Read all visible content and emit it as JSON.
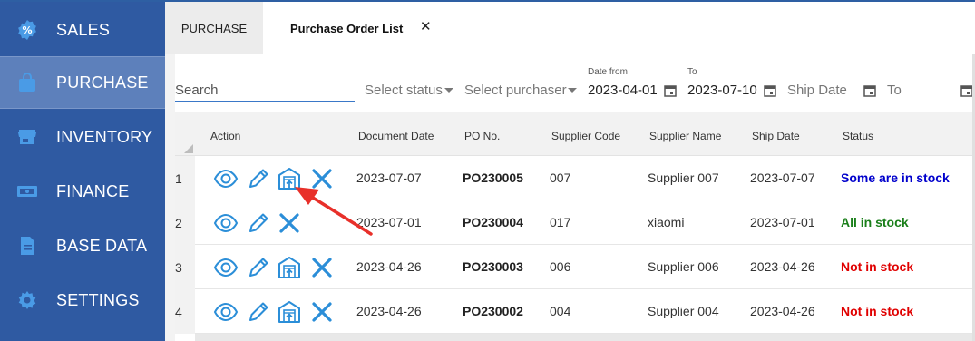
{
  "sidebar": {
    "items": [
      {
        "label": "SALES",
        "icon": "sales-badge-icon",
        "active": false
      },
      {
        "label": "PURCHASE",
        "icon": "shopping-bag-icon",
        "active": true
      },
      {
        "label": "INVENTORY",
        "icon": "store-icon",
        "active": false
      },
      {
        "label": "FINANCE",
        "icon": "cash-icon",
        "active": false
      },
      {
        "label": "BASE DATA",
        "icon": "document-icon",
        "active": false
      },
      {
        "label": "SETTINGS",
        "icon": "gear-icon",
        "active": false
      }
    ],
    "colors": {
      "background": "#2f5aa2",
      "active": "#5d80bb"
    }
  },
  "tabs": {
    "items": [
      {
        "label": "PURCHASE"
      },
      {
        "label": "Purchase Order List",
        "close": "✕"
      }
    ]
  },
  "filters": {
    "search_placeholder": "Search",
    "status_placeholder": "Select status",
    "purchaser_placeholder": "Select purchaser",
    "date_from_label": "Date from",
    "date_from_value": "2023-04-01",
    "date_to_label": "To",
    "date_to_value": "2023-07-10",
    "ship_date_placeholder": "Ship Date",
    "ship_to_placeholder": "To"
  },
  "table": {
    "headers": {
      "action": "Action",
      "document_date": "Document Date",
      "po_no": "PO No.",
      "supplier_code": "Supplier Code",
      "supplier_name": "Supplier Name",
      "ship_date": "Ship Date",
      "status": "Status"
    },
    "rows": [
      {
        "num": "1",
        "document_date": "2023-07-07",
        "po_no": "PO230005",
        "supplier_code": "007",
        "supplier_name": "Supplier 007",
        "ship_date": "2023-07-07",
        "status": "Some are in stock",
        "status_color": "#0000cc",
        "has_receive": true
      },
      {
        "num": "2",
        "document_date": "2023-07-01",
        "po_no": "PO230004",
        "supplier_code": "017",
        "supplier_name": "xiaomi",
        "ship_date": "2023-07-01",
        "status": "All in stock",
        "status_color": "#1a7f1a",
        "has_receive": false
      },
      {
        "num": "3",
        "document_date": "2023-04-26",
        "po_no": "PO230003",
        "supplier_code": "006",
        "supplier_name": "Supplier 006",
        "ship_date": "2023-04-26",
        "status": "Not in stock",
        "status_color": "#e00000",
        "has_receive": true
      },
      {
        "num": "4",
        "document_date": "2023-04-26",
        "po_no": "PO230002",
        "supplier_code": "004",
        "supplier_name": "Supplier 004",
        "ship_date": "2023-04-26",
        "status": "Not in stock",
        "status_color": "#e00000",
        "has_receive": true
      }
    ],
    "action_icons": [
      "eye-icon",
      "pencil-icon",
      "warehouse-receive-icon",
      "close-x-icon"
    ],
    "icon_color": "#2b8ed8"
  },
  "annotation": {
    "arrow_color": "#e8302a"
  }
}
